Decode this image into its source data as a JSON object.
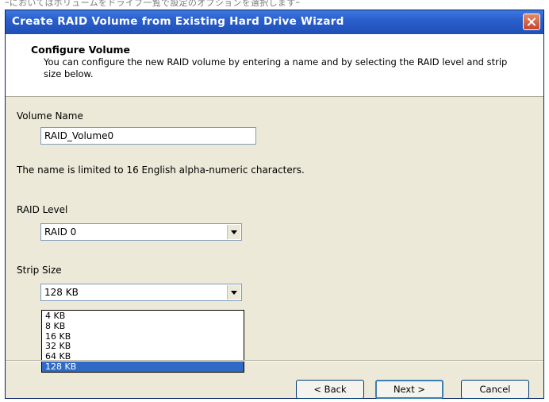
{
  "page_strip_text": "ｰにおいてはボリュームをドライブ一覧で設定のオプションを選択しますｰ",
  "window": {
    "title": "Create RAID Volume from Existing Hard Drive Wizard"
  },
  "header": {
    "title": "Configure Volume",
    "description": "You can configure the new RAID volume by entering a name and by selecting the RAID level and strip size below."
  },
  "form": {
    "volume_name_label": "Volume Name",
    "volume_name_value": "RAID_Volume0",
    "name_hint": "The name is limited to 16 English alpha-numeric characters.",
    "raid_level_label": "RAID Level",
    "raid_level_value": "RAID 0",
    "strip_size_label": "Strip Size",
    "strip_size_value": "128 KB",
    "strip_size_options": [
      "4 KB",
      "8 KB",
      "16 KB",
      "32 KB",
      "64 KB",
      "128 KB"
    ],
    "strip_size_selected_index": 5
  },
  "buttons": {
    "back": "< Back",
    "next": "Next >",
    "cancel": "Cancel"
  },
  "colors": {
    "title_bar": "#2a5fcc",
    "dialog_bg": "#ece9d8",
    "selection": "#316ac5"
  }
}
